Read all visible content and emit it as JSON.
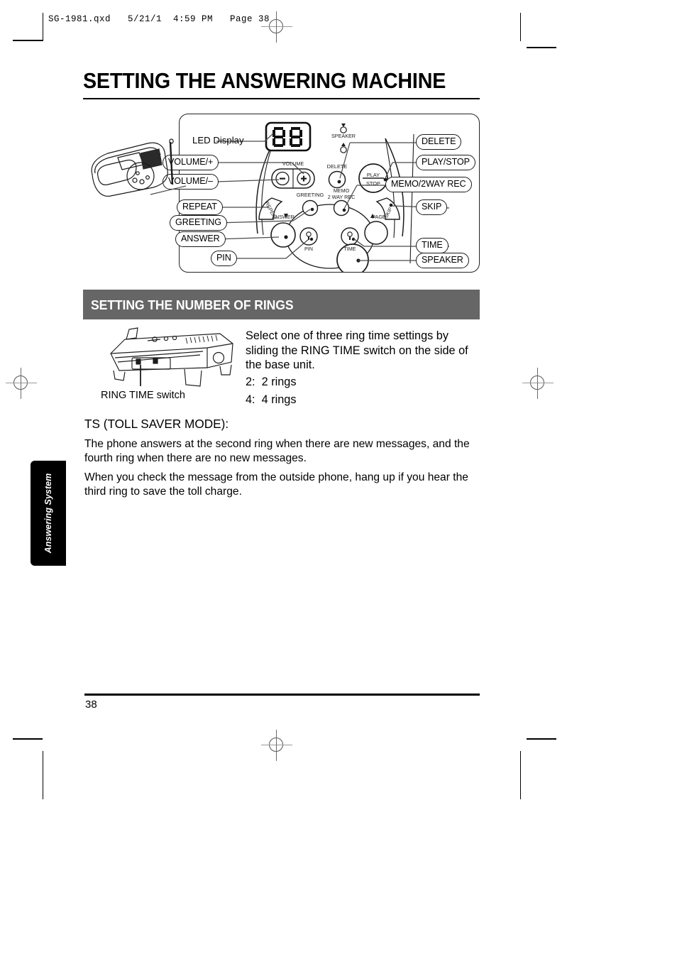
{
  "file_header": "SG-1981.qxd   5/21/1  4:59 PM   Page 38",
  "chapter_title": "SETTING THE ANSWERING MACHINE",
  "diagram": {
    "left_callouts": [
      {
        "label": "LED Display",
        "boxed": false
      },
      {
        "label": "VOLUME/+",
        "boxed": true
      },
      {
        "label": "VOLUME/–",
        "boxed": true
      },
      {
        "label": "REPEAT",
        "boxed": true
      },
      {
        "label": "GREETING",
        "boxed": true
      },
      {
        "label": "ANSWER",
        "boxed": true
      },
      {
        "label": "PIN",
        "boxed": true
      }
    ],
    "right_callouts": [
      {
        "label": "DELETE",
        "boxed": true
      },
      {
        "label": "PLAY/STOP",
        "boxed": true
      },
      {
        "label": "MEMO/2WAY REC",
        "boxed": true
      },
      {
        "label": "SKIP",
        "boxed": true
      },
      {
        "label": "TIME",
        "boxed": true
      },
      {
        "label": "SPEAKER",
        "boxed": true
      }
    ],
    "panel_labels": {
      "led_digits": "88",
      "speaker": "SPEAKER",
      "volume": "VOLUME",
      "volume_minus": "–",
      "volume_plus": "+",
      "delete": "DELETE",
      "play": "PLAY",
      "stop": "STOP",
      "greeting": "GREETING",
      "memo_line1": "MEMO",
      "memo_line2": "2 WAY REC",
      "repeat": "REPEAT",
      "skip": "SKIP",
      "answer": "ANSWER",
      "pin": "PIN",
      "time": "TIME",
      "page": "PAGE"
    }
  },
  "section": {
    "heading": "SETTING THE NUMBER OF RINGS",
    "heading_bg": "#666666",
    "heading_color": "#ffffff"
  },
  "illustration": {
    "ring_time_caption": "RING TIME switch"
  },
  "body": {
    "intro": "Select one of three ring time settings by sliding the RING TIME switch on the side of the base unit.",
    "ring_options": [
      "2:  2 rings",
      "4:  4 rings"
    ],
    "ts_heading": "TS (TOLL SAVER MODE):",
    "paragraph_1": "The phone answers at the second ring when there are new messages, and the fourth ring when there are no new messages.",
    "paragraph_2": "When you check the message from the outside phone, hang up if you hear the third ring to save the toll charge."
  },
  "side_tab": {
    "label": "Answering System",
    "bg": "#000000",
    "color": "#ffffff"
  },
  "footer": {
    "page_number": "38"
  }
}
